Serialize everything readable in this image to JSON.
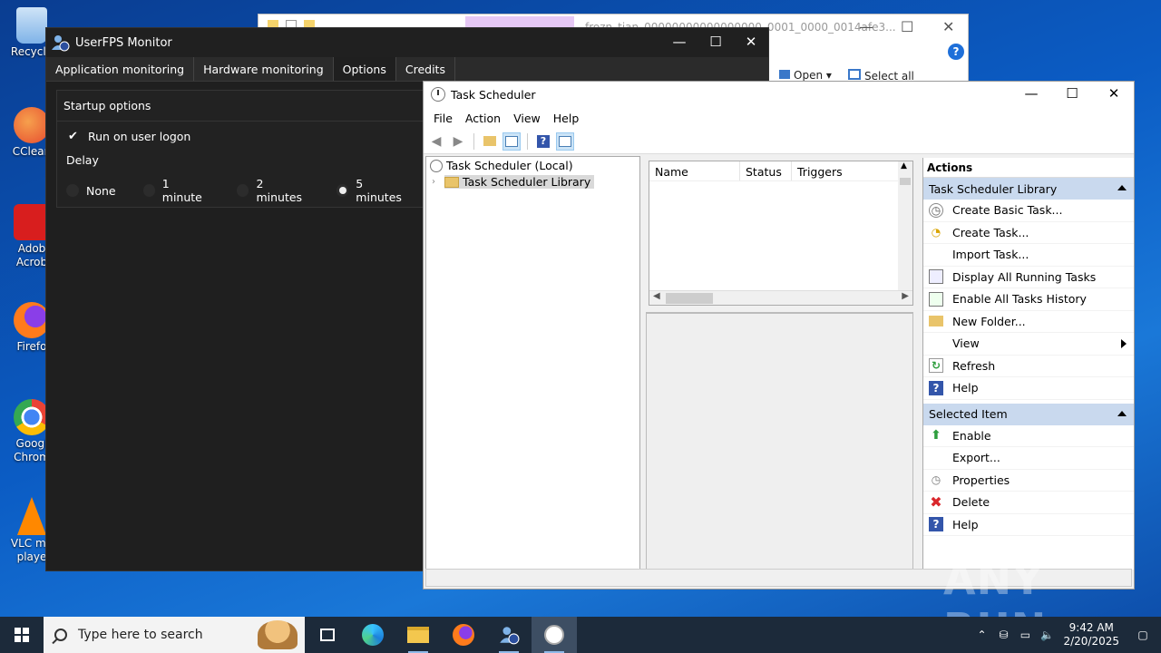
{
  "desktop": {
    "icons": [
      {
        "label": "Recycle",
        "icon": "recycle-bin-icon",
        "color": "#7fb3e8"
      },
      {
        "label": "CClean",
        "icon": "ccleaner-icon",
        "color": "#e64a2e"
      },
      {
        "label": "Adob Acrob",
        "icon": "acrobat-icon",
        "color": "#d81e1e"
      },
      {
        "label": "Firefo",
        "icon": "firefox-icon",
        "color": "#ff7b1c"
      },
      {
        "label": "Googl Chrom",
        "icon": "chrome-icon",
        "color": "#34a853"
      },
      {
        "label": "VLC me playe",
        "icon": "vlc-icon",
        "color": "#ff8800"
      }
    ]
  },
  "explorer": {
    "title": "frozn_tian_00000000000000000_0001_0000_0014afe3...",
    "ribbon_open": "Open ▾",
    "ribbon_select_all": "Select all"
  },
  "userfps": {
    "title": "UserFPS Monitor",
    "tabs": [
      "Application monitoring",
      "Hardware monitoring",
      "Options",
      "Credits"
    ],
    "active_tab": "Options",
    "section_title": "Startup options",
    "run_on_logon": "Run on user logon",
    "delay_label": "Delay",
    "delay_options": [
      "None",
      "1 minute",
      "2 minutes",
      "5 minutes"
    ],
    "selected_delay": "5 minutes"
  },
  "task_scheduler": {
    "title": "Task Scheduler",
    "menu": [
      "File",
      "Action",
      "View",
      "Help"
    ],
    "tree": {
      "root": "Task Scheduler (Local)",
      "child": "Task Scheduler Library"
    },
    "columns": [
      "Name",
      "Status",
      "Triggers"
    ],
    "actions_header": "Actions",
    "group1": "Task Scheduler Library",
    "group1_items": [
      {
        "label": "Create Basic Task...",
        "icon": "create-basic-task-icon"
      },
      {
        "label": "Create Task...",
        "icon": "create-task-icon"
      },
      {
        "label": "Import Task...",
        "icon": ""
      },
      {
        "label": "Display All Running Tasks",
        "icon": "running-tasks-icon"
      },
      {
        "label": "Enable All Tasks History",
        "icon": "tasks-history-icon"
      },
      {
        "label": "New Folder...",
        "icon": "new-folder-icon"
      },
      {
        "label": "View",
        "icon": "",
        "submenu": true
      },
      {
        "label": "Refresh",
        "icon": "refresh-icon"
      },
      {
        "label": "Help",
        "icon": "help-icon"
      }
    ],
    "group2": "Selected Item",
    "group2_items": [
      {
        "label": "Enable",
        "icon": "enable-arrow-icon"
      },
      {
        "label": "Export...",
        "icon": ""
      },
      {
        "label": "Properties",
        "icon": "properties-icon"
      },
      {
        "label": "Delete",
        "icon": "delete-icon"
      },
      {
        "label": "Help",
        "icon": "help-icon"
      }
    ]
  },
  "watermark": "ANY RUN",
  "taskbar": {
    "search_placeholder": "Type here to search",
    "time": "9:42 AM",
    "date": "2/20/2025"
  }
}
